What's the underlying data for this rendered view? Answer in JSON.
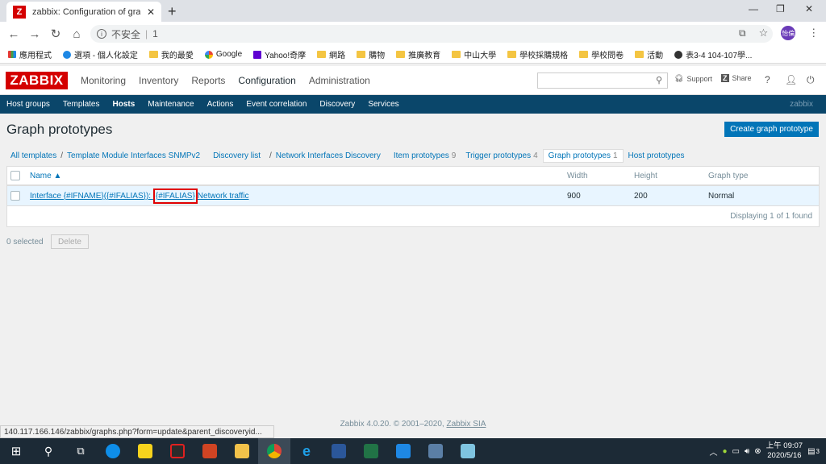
{
  "browser": {
    "tab_title": "zabbix: Configuration of graph",
    "tab_favicon": "Z",
    "tab_close": "✕",
    "new_tab": "+",
    "url_security": "不安全",
    "url_text": "1",
    "avatar_text": "怡倫",
    "bookmarks": [
      "應用程式",
      "選項 - 個人化設定",
      "我的最愛",
      "Google",
      "Yahoo!奇摩",
      "網路",
      "購物",
      "推廣教育",
      "中山大學",
      "學校採購規格",
      "學校問卷",
      "活動",
      "表3-4 104-107學..."
    ],
    "status_url": "140.117.166.146/zabbix/graphs.php?form=update&parent_discoveryid..."
  },
  "zabbix": {
    "logo": "ZABBIX",
    "top_menu": [
      "Monitoring",
      "Inventory",
      "Reports",
      "Configuration",
      "Administration"
    ],
    "support_label": "Support",
    "share_label": "Share",
    "help_label": "?",
    "sub_menu": [
      "Host groups",
      "Templates",
      "Hosts",
      "Maintenance",
      "Actions",
      "Event correlation",
      "Discovery",
      "Services"
    ],
    "sub_menu_right": "zabbix",
    "page_title": "Graph prototypes",
    "create_button": "Create graph prototype",
    "breadcrumbs": {
      "all_templates": "All templates",
      "template": "Template Module Interfaces SNMPv2",
      "discovery_list": "Discovery list",
      "discovery_rule": "Network Interfaces Discovery",
      "item_prototypes": "Item prototypes",
      "item_prototypes_count": "9",
      "trigger_prototypes": "Trigger prototypes",
      "trigger_prototypes_count": "4",
      "graph_prototypes": "Graph prototypes",
      "graph_prototypes_count": "1",
      "host_prototypes": "Host prototypes"
    },
    "table": {
      "headers": {
        "name": "Name ▲",
        "width": "Width",
        "height": "Height",
        "graph_type": "Graph type"
      },
      "rows": [
        {
          "name_prefix": "Interface {#IFNAME}({#IFALIAS}): ",
          "name_highlight": "{#IFALIAS}",
          "name_suffix": "Network traffic",
          "width": "900",
          "height": "200",
          "graph_type": "Normal"
        }
      ],
      "footer": "Displaying 1 of 1 found"
    },
    "selected_count": "0 selected",
    "delete_button": "Delete",
    "footer_text": "Zabbix 4.0.20. © 2001–2020,",
    "footer_link": "Zabbix SIA"
  },
  "taskbar": {
    "time": "上午 09:07",
    "date": "2020/5/16",
    "notifications": "3"
  }
}
